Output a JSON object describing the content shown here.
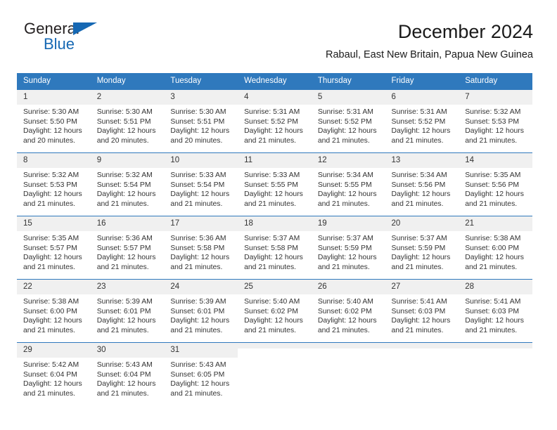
{
  "brand": {
    "word_one": "General",
    "word_two": "Blue",
    "flag_icon": "triangle-flag-icon"
  },
  "header": {
    "title": "December 2024",
    "subtitle": "Rabaul, East New Britain, Papua New Guinea"
  },
  "colors": {
    "header_blue": "#2f79bd",
    "brand_blue": "#1668b3",
    "daynum_bg": "#f0f0f0",
    "text": "#333333"
  },
  "calendar": {
    "weekday_headers": [
      "Sunday",
      "Monday",
      "Tuesday",
      "Wednesday",
      "Thursday",
      "Friday",
      "Saturday"
    ],
    "labels": {
      "sunrise": "Sunrise:",
      "sunset": "Sunset:",
      "daylight": "Daylight:"
    },
    "weeks": [
      [
        {
          "day": "1",
          "sunrise": "Sunrise: 5:30 AM",
          "sunset": "Sunset: 5:50 PM",
          "daylight": "Daylight: 12 hours and 20 minutes."
        },
        {
          "day": "2",
          "sunrise": "Sunrise: 5:30 AM",
          "sunset": "Sunset: 5:51 PM",
          "daylight": "Daylight: 12 hours and 20 minutes."
        },
        {
          "day": "3",
          "sunrise": "Sunrise: 5:30 AM",
          "sunset": "Sunset: 5:51 PM",
          "daylight": "Daylight: 12 hours and 20 minutes."
        },
        {
          "day": "4",
          "sunrise": "Sunrise: 5:31 AM",
          "sunset": "Sunset: 5:52 PM",
          "daylight": "Daylight: 12 hours and 21 minutes."
        },
        {
          "day": "5",
          "sunrise": "Sunrise: 5:31 AM",
          "sunset": "Sunset: 5:52 PM",
          "daylight": "Daylight: 12 hours and 21 minutes."
        },
        {
          "day": "6",
          "sunrise": "Sunrise: 5:31 AM",
          "sunset": "Sunset: 5:52 PM",
          "daylight": "Daylight: 12 hours and 21 minutes."
        },
        {
          "day": "7",
          "sunrise": "Sunrise: 5:32 AM",
          "sunset": "Sunset: 5:53 PM",
          "daylight": "Daylight: 12 hours and 21 minutes."
        }
      ],
      [
        {
          "day": "8",
          "sunrise": "Sunrise: 5:32 AM",
          "sunset": "Sunset: 5:53 PM",
          "daylight": "Daylight: 12 hours and 21 minutes."
        },
        {
          "day": "9",
          "sunrise": "Sunrise: 5:32 AM",
          "sunset": "Sunset: 5:54 PM",
          "daylight": "Daylight: 12 hours and 21 minutes."
        },
        {
          "day": "10",
          "sunrise": "Sunrise: 5:33 AM",
          "sunset": "Sunset: 5:54 PM",
          "daylight": "Daylight: 12 hours and 21 minutes."
        },
        {
          "day": "11",
          "sunrise": "Sunrise: 5:33 AM",
          "sunset": "Sunset: 5:55 PM",
          "daylight": "Daylight: 12 hours and 21 minutes."
        },
        {
          "day": "12",
          "sunrise": "Sunrise: 5:34 AM",
          "sunset": "Sunset: 5:55 PM",
          "daylight": "Daylight: 12 hours and 21 minutes."
        },
        {
          "day": "13",
          "sunrise": "Sunrise: 5:34 AM",
          "sunset": "Sunset: 5:56 PM",
          "daylight": "Daylight: 12 hours and 21 minutes."
        },
        {
          "day": "14",
          "sunrise": "Sunrise: 5:35 AM",
          "sunset": "Sunset: 5:56 PM",
          "daylight": "Daylight: 12 hours and 21 minutes."
        }
      ],
      [
        {
          "day": "15",
          "sunrise": "Sunrise: 5:35 AM",
          "sunset": "Sunset: 5:57 PM",
          "daylight": "Daylight: 12 hours and 21 minutes."
        },
        {
          "day": "16",
          "sunrise": "Sunrise: 5:36 AM",
          "sunset": "Sunset: 5:57 PM",
          "daylight": "Daylight: 12 hours and 21 minutes."
        },
        {
          "day": "17",
          "sunrise": "Sunrise: 5:36 AM",
          "sunset": "Sunset: 5:58 PM",
          "daylight": "Daylight: 12 hours and 21 minutes."
        },
        {
          "day": "18",
          "sunrise": "Sunrise: 5:37 AM",
          "sunset": "Sunset: 5:58 PM",
          "daylight": "Daylight: 12 hours and 21 minutes."
        },
        {
          "day": "19",
          "sunrise": "Sunrise: 5:37 AM",
          "sunset": "Sunset: 5:59 PM",
          "daylight": "Daylight: 12 hours and 21 minutes."
        },
        {
          "day": "20",
          "sunrise": "Sunrise: 5:37 AM",
          "sunset": "Sunset: 5:59 PM",
          "daylight": "Daylight: 12 hours and 21 minutes."
        },
        {
          "day": "21",
          "sunrise": "Sunrise: 5:38 AM",
          "sunset": "Sunset: 6:00 PM",
          "daylight": "Daylight: 12 hours and 21 minutes."
        }
      ],
      [
        {
          "day": "22",
          "sunrise": "Sunrise: 5:38 AM",
          "sunset": "Sunset: 6:00 PM",
          "daylight": "Daylight: 12 hours and 21 minutes."
        },
        {
          "day": "23",
          "sunrise": "Sunrise: 5:39 AM",
          "sunset": "Sunset: 6:01 PM",
          "daylight": "Daylight: 12 hours and 21 minutes."
        },
        {
          "day": "24",
          "sunrise": "Sunrise: 5:39 AM",
          "sunset": "Sunset: 6:01 PM",
          "daylight": "Daylight: 12 hours and 21 minutes."
        },
        {
          "day": "25",
          "sunrise": "Sunrise: 5:40 AM",
          "sunset": "Sunset: 6:02 PM",
          "daylight": "Daylight: 12 hours and 21 minutes."
        },
        {
          "day": "26",
          "sunrise": "Sunrise: 5:40 AM",
          "sunset": "Sunset: 6:02 PM",
          "daylight": "Daylight: 12 hours and 21 minutes."
        },
        {
          "day": "27",
          "sunrise": "Sunrise: 5:41 AM",
          "sunset": "Sunset: 6:03 PM",
          "daylight": "Daylight: 12 hours and 21 minutes."
        },
        {
          "day": "28",
          "sunrise": "Sunrise: 5:41 AM",
          "sunset": "Sunset: 6:03 PM",
          "daylight": "Daylight: 12 hours and 21 minutes."
        }
      ],
      [
        {
          "day": "29",
          "sunrise": "Sunrise: 5:42 AM",
          "sunset": "Sunset: 6:04 PM",
          "daylight": "Daylight: 12 hours and 21 minutes."
        },
        {
          "day": "30",
          "sunrise": "Sunrise: 5:43 AM",
          "sunset": "Sunset: 6:04 PM",
          "daylight": "Daylight: 12 hours and 21 minutes."
        },
        {
          "day": "31",
          "sunrise": "Sunrise: 5:43 AM",
          "sunset": "Sunset: 6:05 PM",
          "daylight": "Daylight: 12 hours and 21 minutes."
        },
        {
          "day": "",
          "sunrise": "",
          "sunset": "",
          "daylight": ""
        },
        {
          "day": "",
          "sunrise": "",
          "sunset": "",
          "daylight": ""
        },
        {
          "day": "",
          "sunrise": "",
          "sunset": "",
          "daylight": ""
        },
        {
          "day": "",
          "sunrise": "",
          "sunset": "",
          "daylight": ""
        }
      ]
    ]
  }
}
